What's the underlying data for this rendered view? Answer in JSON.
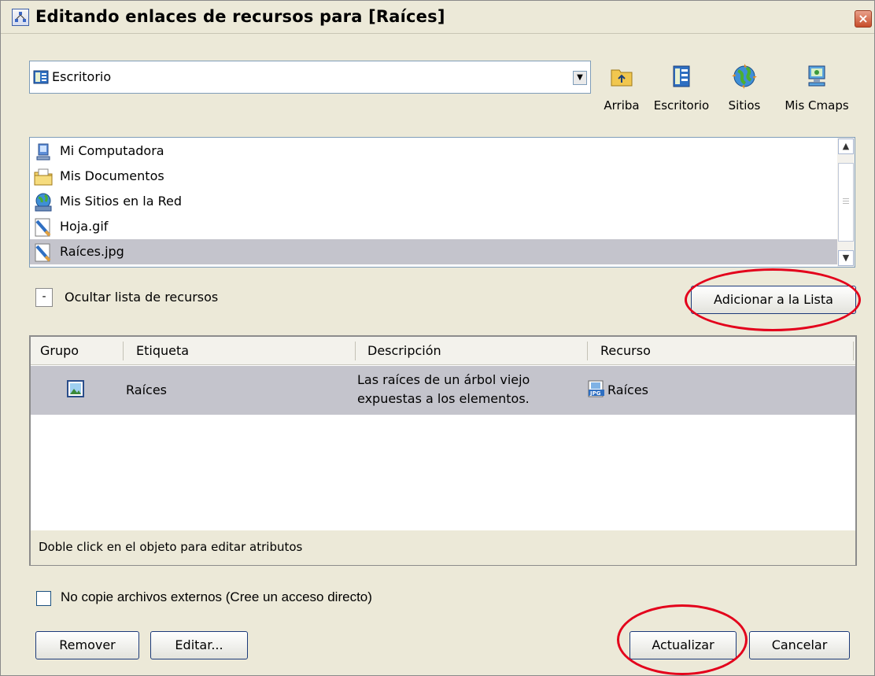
{
  "window": {
    "title": "Editando enlaces de recursos para [Raíces]",
    "close_symbol": "×"
  },
  "location": {
    "selected": "Escritorio",
    "icon": "desktop-icon"
  },
  "nav_buttons": [
    {
      "label": "Arriba",
      "icon": "folder-up-icon"
    },
    {
      "label": "Escritorio",
      "icon": "desktop-icon"
    },
    {
      "label": "Sitios",
      "icon": "globe-icon"
    },
    {
      "label": "Mis Cmaps",
      "icon": "computer-icon"
    }
  ],
  "file_list": {
    "items": [
      {
        "name": "Mi Computadora",
        "icon": "computer-icon"
      },
      {
        "name": "Mis Documentos",
        "icon": "documents-folder-icon"
      },
      {
        "name": "Mis Sitios en la Red",
        "icon": "network-globe-icon"
      },
      {
        "name": "Hoja.gif",
        "icon": "image-file-icon"
      },
      {
        "name": "Raíces.jpg",
        "icon": "image-file-icon",
        "selected": true
      }
    ]
  },
  "resource_toggle": {
    "symbol": "-",
    "label": "Ocultar lista de recursos"
  },
  "add_button": {
    "label": "Adicionar a la Lista"
  },
  "table": {
    "columns": [
      "Grupo",
      "Etiqueta",
      "Descripción",
      "Recurso"
    ],
    "rows": [
      {
        "group_icon": "image-group-icon",
        "label": "Raíces",
        "description_line1": "Las raíces de un árbol viejo",
        "description_line2": "expuestas a los elementos.",
        "resource_icon": "jpg-file-icon",
        "resource": "Raíces"
      }
    ],
    "footer": "Doble click en el objeto para editar atributos"
  },
  "no_copy_checkbox": {
    "label": "No copie archivos externos (Cree un acceso directo)",
    "checked": false
  },
  "buttons": {
    "remove": "Remover",
    "edit": "Editar...",
    "update": "Actualizar",
    "cancel": "Cancelar"
  },
  "colors": {
    "dialog_bg": "#ece9d8",
    "selection": "#c4c4cc",
    "highlight_ellipse": "#e3001b",
    "button_border": "#1c3a7a"
  }
}
